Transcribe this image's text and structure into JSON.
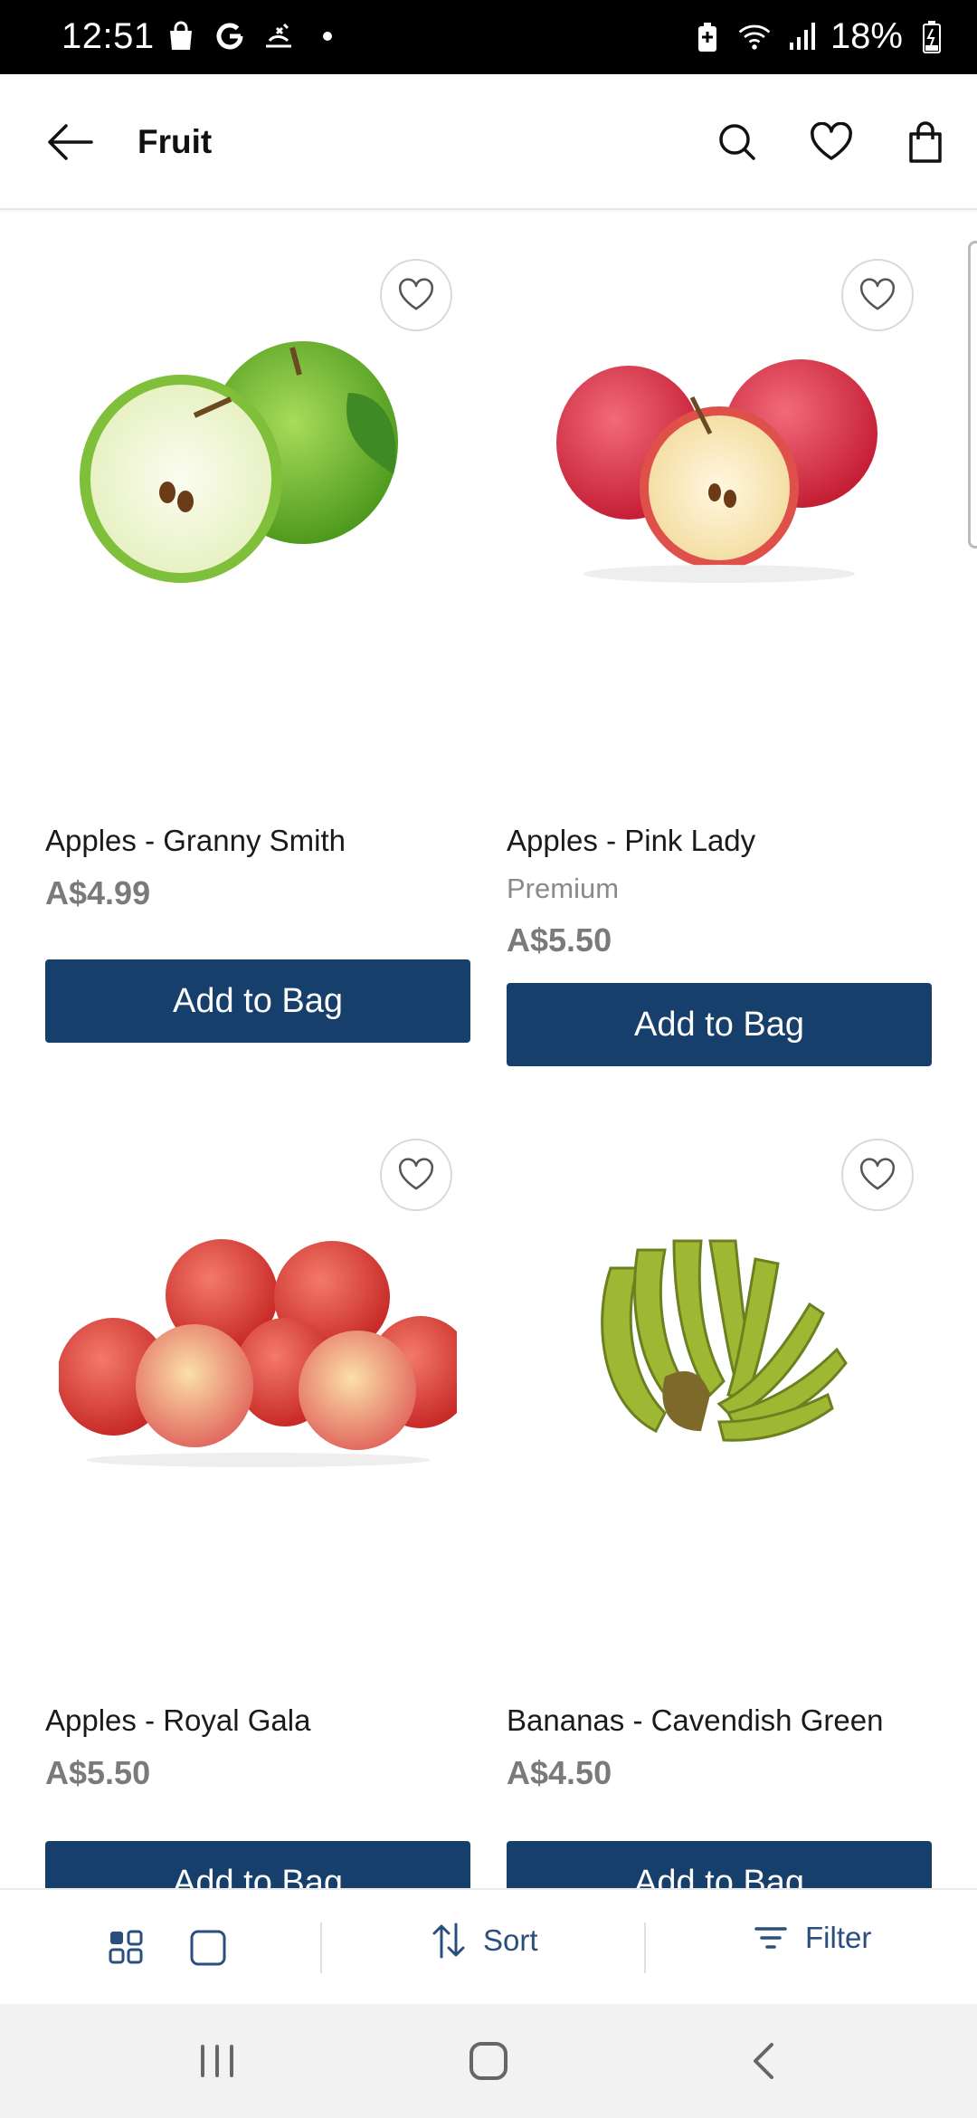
{
  "status_bar": {
    "time": "12:51",
    "battery": "18%",
    "left_icons": [
      "shopping-bag-icon",
      "google-icon",
      "pet-icon",
      "dot-icon"
    ],
    "right_icons": [
      "battery-saver-icon",
      "wifi-icon",
      "signal-icon",
      "battery-icon"
    ]
  },
  "app_bar": {
    "title": "Fruit"
  },
  "products": [
    {
      "name": "Apples - Granny Smith",
      "subtitle": "",
      "price": "A$4.99",
      "button": "Add to Bag",
      "image": "green-apples"
    },
    {
      "name": "Apples - Pink Lady",
      "subtitle": "Premium",
      "price": "A$5.50",
      "button": "Add to Bag",
      "image": "pink-apples"
    },
    {
      "name": "Apples - Royal Gala",
      "subtitle": "",
      "price": "A$5.50",
      "button": "Add to Bag",
      "image": "gala-apples"
    },
    {
      "name": "Bananas - Cavendish Green",
      "subtitle": "",
      "price": "A$4.50",
      "button": "Add to Bag",
      "image": "green-bananas"
    }
  ],
  "toolbar": {
    "sort_label": "Sort",
    "filter_label": "Filter"
  },
  "colors": {
    "button_bg": "#163f6c",
    "toolbar_accent": "#2a4f7c",
    "price": "#7a7a7a"
  }
}
